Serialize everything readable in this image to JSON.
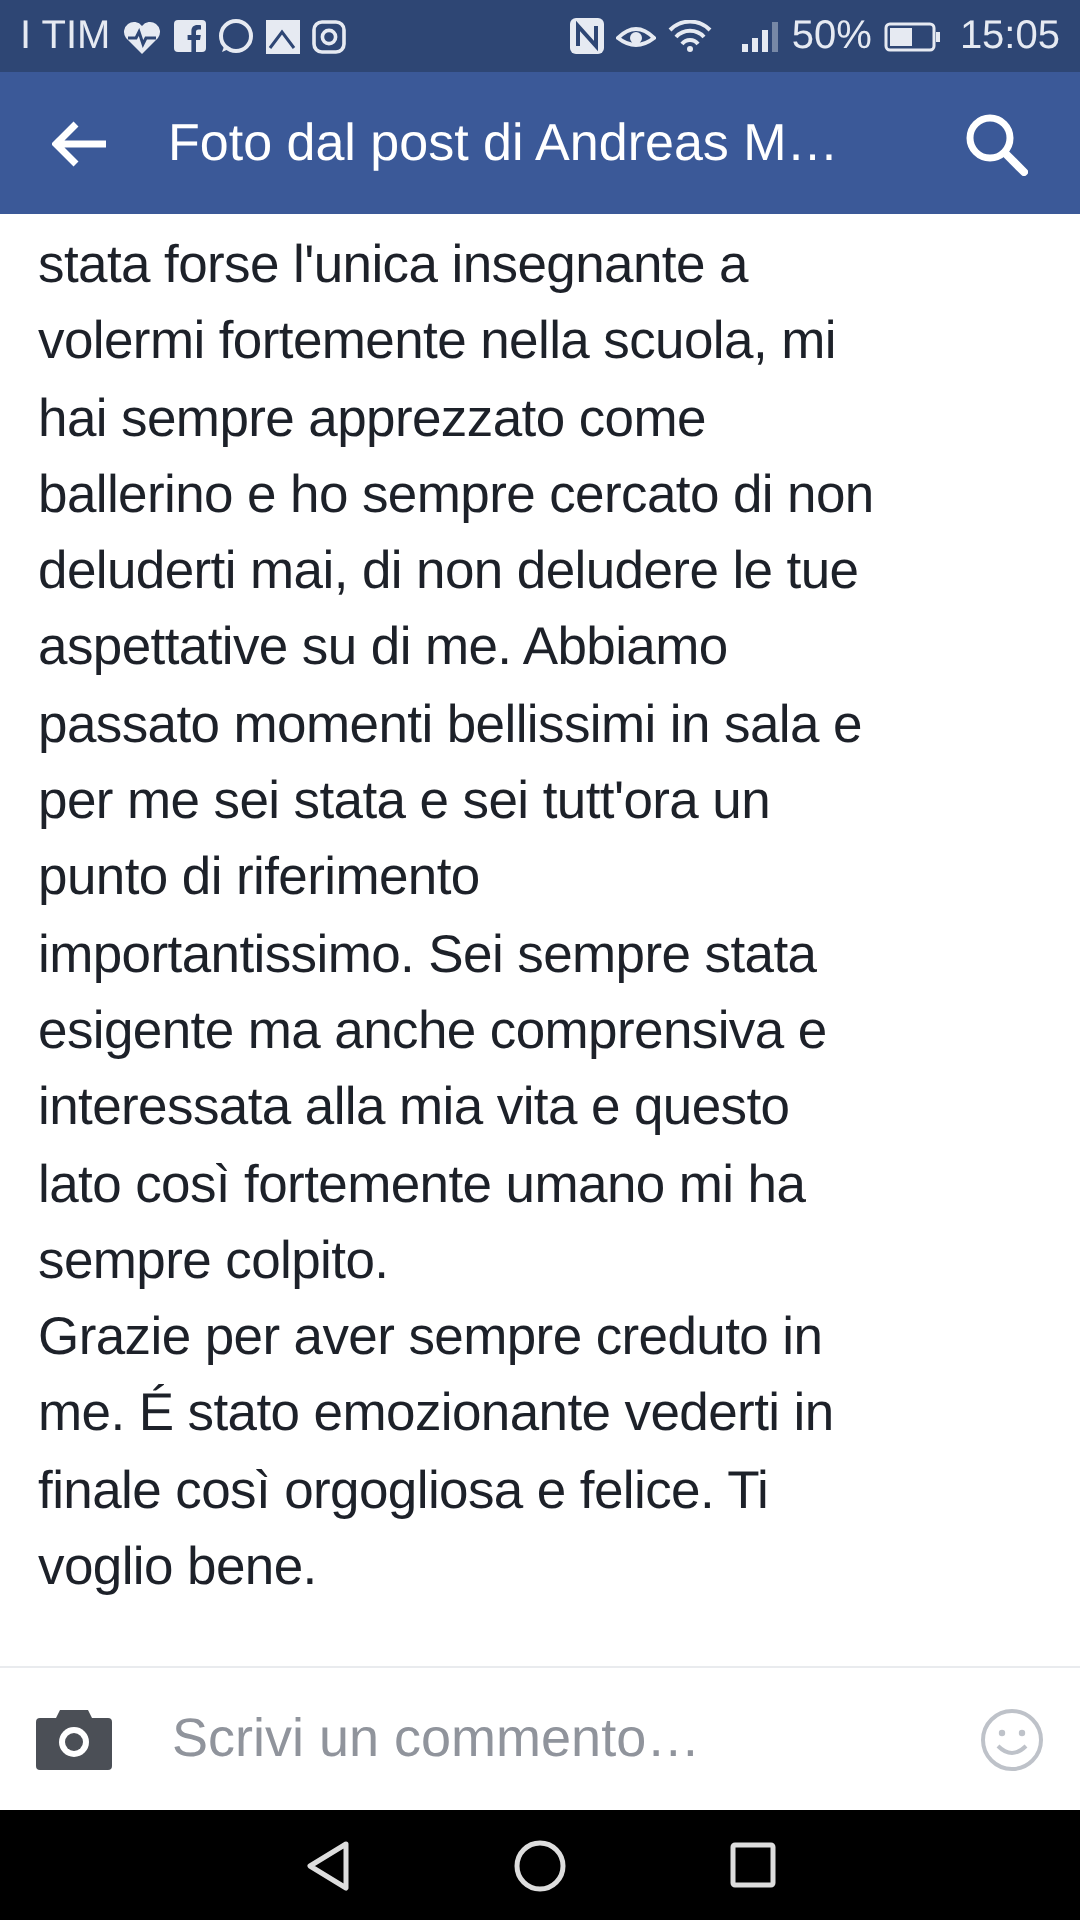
{
  "status_bar": {
    "carrier": "I TIM",
    "battery_percent": "50%",
    "time": "15:05"
  },
  "app_bar": {
    "title": "Foto dal post di Andreas M…"
  },
  "post": {
    "paragraphs": [
      [
        "stata forse l'unica insegnante a",
        "volermi fortemente nella scuola, mi",
        "hai sempre apprezzato come",
        "ballerino e ho sempre cercato di non",
        "deluderti mai, di non deludere le tue",
        "aspettative su di me. Abbiamo",
        "passato momenti bellissimi in sala e",
        "per me sei stata e sei tutt'ora un",
        "punto di riferimento",
        "importantissimo. Sei sempre stata",
        "esigente ma anche comprensiva e",
        "interessata alla mia vita e questo",
        "lato così fortemente umano mi ha",
        "sempre colpito."
      ],
      [
        "Grazie per aver sempre creduto in",
        "me. É stato emozionante vederti in",
        "finale così orgogliosa e felice. Ti",
        "voglio bene."
      ]
    ]
  },
  "comment_bar": {
    "placeholder": "Scrivi un commento…"
  }
}
